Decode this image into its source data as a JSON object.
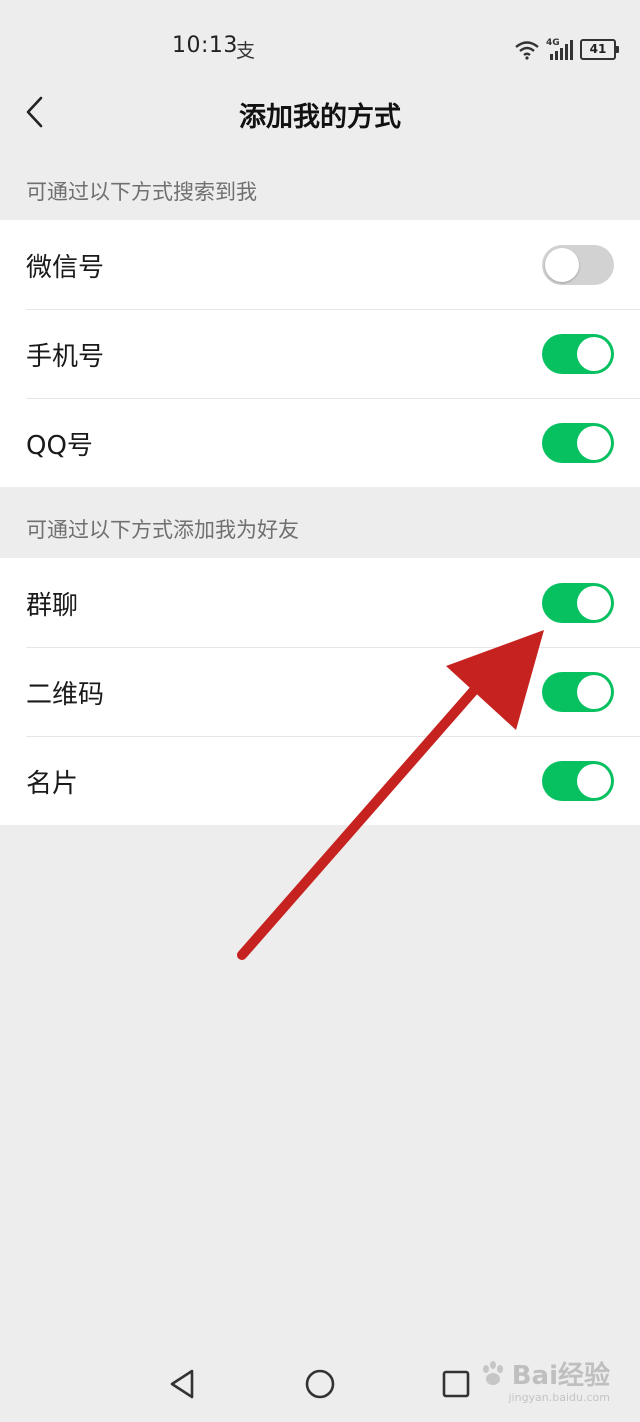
{
  "status_bar": {
    "time": "10:13",
    "alipay_glyph": "支",
    "network": "4G",
    "battery": "41"
  },
  "header": {
    "title": "添加我的方式",
    "back_icon": "chevron-left-icon"
  },
  "search_section": {
    "header": "可通过以下方式搜索到我",
    "items": [
      {
        "label": "微信号",
        "enabled": false
      },
      {
        "label": "手机号",
        "enabled": true
      },
      {
        "label": "QQ号",
        "enabled": true
      }
    ]
  },
  "add_section": {
    "header": "可通过以下方式添加我为好友",
    "items": [
      {
        "label": "群聊",
        "enabled": true
      },
      {
        "label": "二维码",
        "enabled": true
      },
      {
        "label": "名片",
        "enabled": true
      }
    ]
  },
  "colors": {
    "toggle_on": "#07c160",
    "toggle_off": "#d2d2d2",
    "annotation_arrow": "#c62320",
    "background": "#ededed"
  },
  "watermark": {
    "text": "Bai经验",
    "sub": "jingyan.baidu.com"
  }
}
